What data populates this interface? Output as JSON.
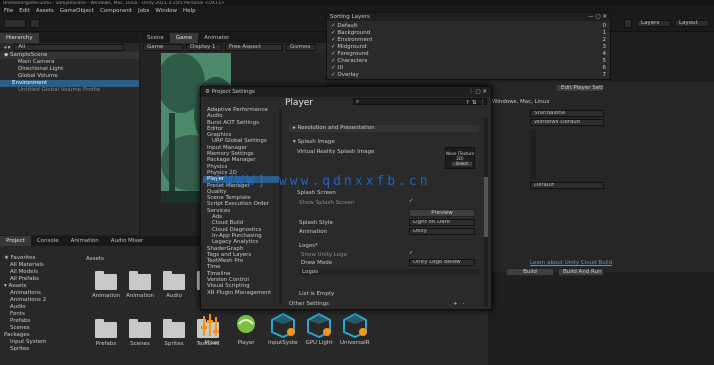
{
  "menu": {
    "title": "Unitedimrgame.unitu - SampleScene - Windows, Mac, Linux - Unity 2021.3.15f1 Personal <DX11>",
    "items": [
      "File",
      "Edit",
      "Assets",
      "GameObject",
      "Component",
      "Jobs",
      "Window",
      "Help"
    ]
  },
  "toolbar": {
    "layers": "Layers",
    "layout": "Layout"
  },
  "hierarchy": {
    "tab": "Hierarchy",
    "search": "All",
    "items": [
      "SampleScene",
      "Main Camera",
      "Directional Light",
      "Global Volume",
      "Environment",
      "Untitled Global Volume Profile"
    ]
  },
  "scene": {
    "tabs": [
      "Scene",
      "Game",
      "Animator"
    ],
    "display": "Game",
    "display_num": "Display 1",
    "resolution": "Free Aspect",
    "gizmos": "Gizmos"
  },
  "layers_popup": {
    "title": "Sorting Layers",
    "items": [
      "Default",
      "Background",
      "Environment",
      "Midground",
      "Foreground",
      "Characters",
      "UI",
      "Overlay"
    ],
    "values": [
      "0",
      "1",
      "2",
      "3",
      "4",
      "5",
      "6",
      "7"
    ]
  },
  "inspector": {
    "platform": "Windows, Mac, Linux",
    "btn": "Edit Player Settings",
    "dropdowns": [
      "Standalone",
      "Windows Default"
    ],
    "deploy": "Default",
    "link": "Learn about Unity Cloud Build",
    "build": "Build",
    "build_run": "Build And Run"
  },
  "watermark": "[WWW] www.qdnxxfb.cn",
  "project_settings": {
    "title": "Project Settings",
    "header": "Player",
    "search_placeholder": "",
    "nav": [
      "Adaptive Performance",
      "Audio",
      "Burst AOT Settings",
      "Editor",
      "Graphics",
      "URP Global Settings",
      "Input Manager",
      "Memory Settings",
      "Package Manager",
      "Physics",
      "Physics 2D",
      "Player",
      "Preset Manager",
      "Quality",
      "Scene Template",
      "Script Execution Order",
      "Services",
      "Ads",
      "Cloud Build",
      "Cloud Diagnostics",
      "In-App Purchasing",
      "Legacy Analytics",
      "ShaderGraph",
      "Tags and Layers",
      "TextMesh Pro",
      "Time",
      "Timeline",
      "Version Control",
      "Visual Scripting",
      "XR Plugin Management"
    ],
    "section": "Resolution and Presentation",
    "splash_section": "Splash Image",
    "virtual_reality": "Virtual Reality Splash Image",
    "none_label": "None (Texture 2D)",
    "select": "Select",
    "splash_screen": "Splash Screen",
    "show_splash": "Show Splash Screen",
    "preview": "Preview",
    "splash_style": "Splash Style",
    "splash_style_val": "Light on Dark",
    "animation": "Animation",
    "animation_val": "Dolly",
    "logos": "Logos*",
    "show_unity_logo": "Show Unity Logo",
    "draw_mode": "Draw Mode",
    "draw_mode_val": "Unity Logo Below",
    "logos_list": "Logos",
    "list_empty": "List is Empty",
    "other": "Other Settings",
    "plus": "+",
    "minus": "-"
  },
  "project": {
    "tabs": [
      "Project",
      "Console",
      "Animation",
      "Audio Mixer"
    ],
    "root": "Favorites",
    "tree": [
      "All Materials",
      "All Models",
      "All Prefabs",
      "Assets",
      "Animations",
      "Animations 2",
      "Audio",
      "Fonts",
      "Prefabs",
      "Scenes",
      "Packages",
      "Input System",
      "Sprites",
      "Textures"
    ],
    "breadcrumb": "Assets",
    "assets": [
      {
        "name": "Animations",
        "type": "folder"
      },
      {
        "name": "Animations2",
        "type": "folder"
      },
      {
        "name": "Audio",
        "type": "folder"
      },
      {
        "name": "Fonts",
        "type": "folder"
      },
      {
        "name": "Prefabs",
        "type": "folder"
      },
      {
        "name": "Scenes",
        "type": "folder"
      },
      {
        "name": "Sprites",
        "type": "folder"
      },
      {
        "name": "Textures",
        "type": "folder"
      },
      {
        "name": "Mixer",
        "type": "mixer"
      },
      {
        "name": "Player",
        "type": "player"
      },
      {
        "name": "InputSystem",
        "type": "cube"
      },
      {
        "name": "GPU Light",
        "type": "cube"
      },
      {
        "name": "UniversalRP",
        "type": "cube"
      }
    ]
  },
  "colors": {
    "accent": "#2c5d87",
    "bg": "#1e1e1e",
    "panel": "#282828",
    "forest": "#3f6e5a",
    "orange": "#f7941d",
    "cyan": "#27a6cf"
  }
}
